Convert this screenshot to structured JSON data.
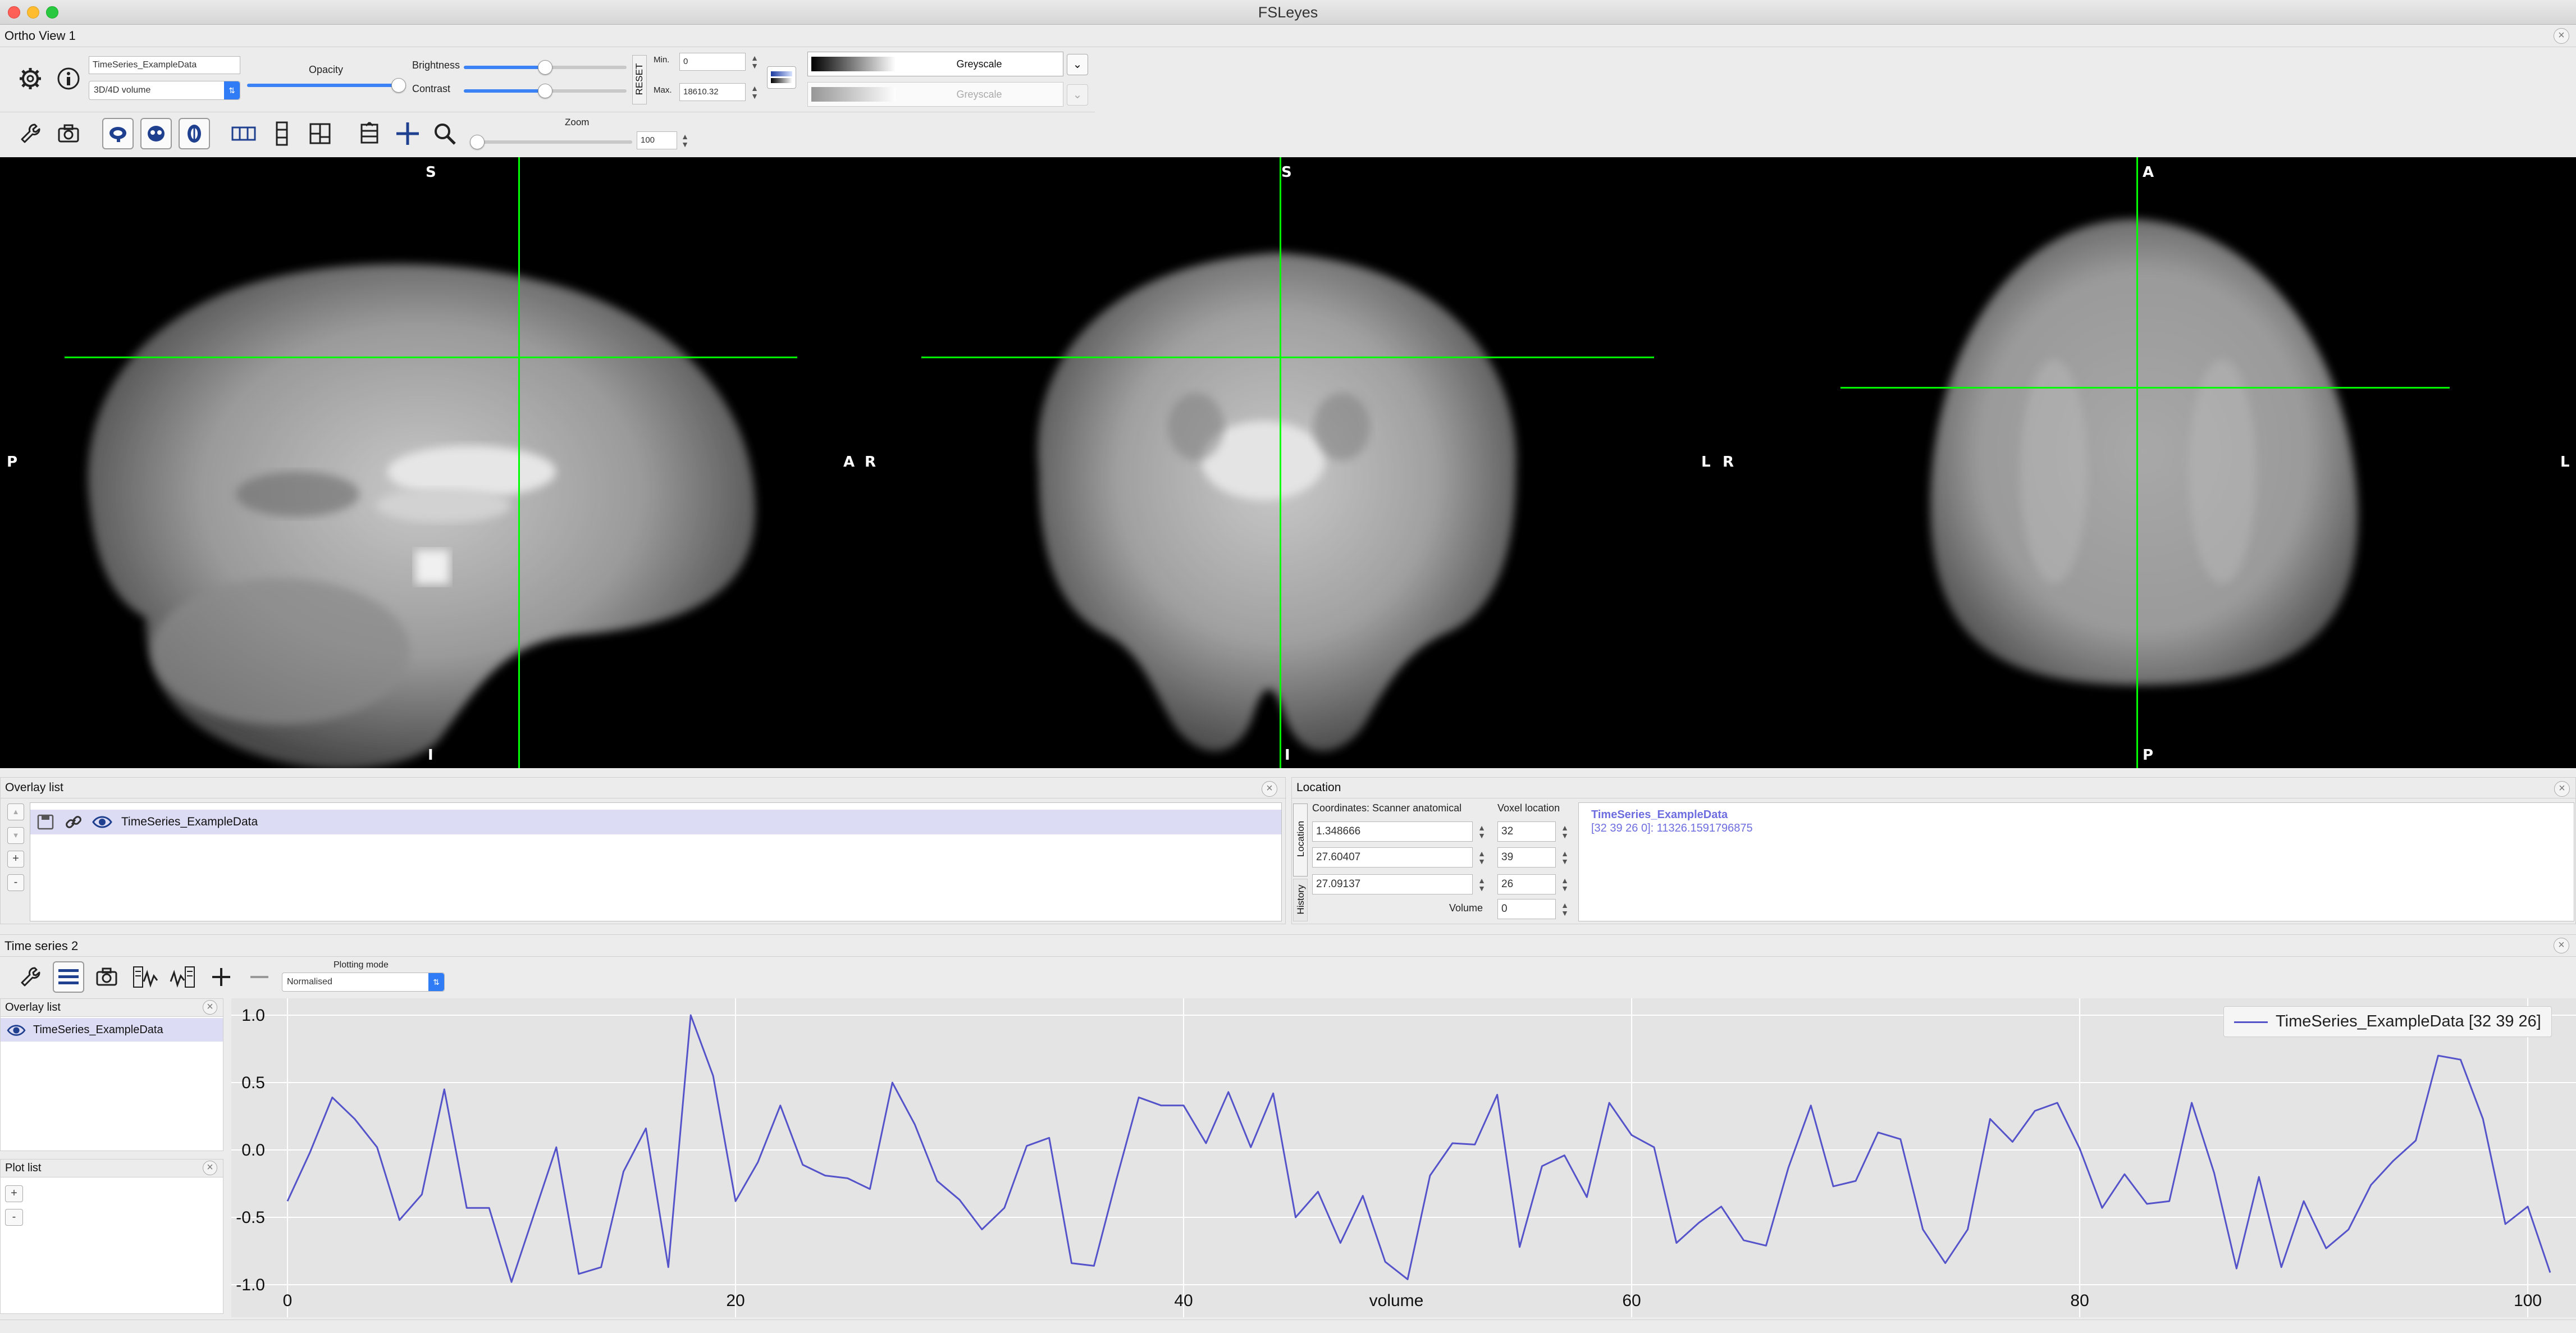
{
  "window": {
    "title": "FSLeyes"
  },
  "ortho": {
    "panel_title": "Ortho View 1",
    "overlay_name": "TimeSeries_ExampleData",
    "overlay_type": "3D/4D volume",
    "opacity_label": "Opacity",
    "brightness_label": "Brightness",
    "contrast_label": "Contrast",
    "reset_label": "RESET",
    "min_label": "Min.",
    "max_label": "Max.",
    "min_value": "0",
    "max_value": "18610.32",
    "colormap": "Greyscale",
    "neg_colormap": "Greyscale",
    "zoom_label": "Zoom",
    "zoom_value": "100",
    "opacity": 1.0,
    "brightness": 0.5,
    "contrast": 0.5,
    "zoom_level": 0.0,
    "views": {
      "sagittal": {
        "top": "S",
        "bottom": "I",
        "left": "P",
        "right": "A"
      },
      "coronal": {
        "top": "S",
        "bottom": "I",
        "left": "R",
        "right": "L"
      },
      "axial": {
        "top": "A",
        "bottom": "P",
        "left": "R",
        "right": "L"
      }
    }
  },
  "overlay_list": {
    "title": "Overlay list",
    "items": [
      {
        "name": "TimeSeries_ExampleData"
      }
    ],
    "buttons": {
      "up": "▲",
      "down": "▼",
      "add": "+",
      "remove": "-"
    }
  },
  "location": {
    "title": "Location",
    "tab_location": "Location",
    "tab_history": "History",
    "coords_header": "Coordinates: Scanner anatomical",
    "voxel_header": "Voxel location",
    "coords": [
      "1.348666",
      "27.60407",
      "27.09137"
    ],
    "voxels": [
      "32",
      "39",
      "26"
    ],
    "volume_label": "Volume",
    "volume_value": "0",
    "info_name": "TimeSeries_ExampleData",
    "info_value": "[32 39 26 0]: 11326.1591796875"
  },
  "timeseries": {
    "panel_title": "Time series 2",
    "plotting_mode_label": "Plotting mode",
    "plotting_mode": "Normalised",
    "overlay_list_title": "Overlay list",
    "overlay_item": "TimeSeries_ExampleData",
    "plot_list_title": "Plot list",
    "plot_buttons": {
      "add": "+",
      "remove": "-"
    }
  },
  "colors": {
    "series": "#5553c9",
    "crosshair": "#00ff00",
    "accent": "#2f7cf6",
    "selection": "#dcdcf5",
    "plot_bg": "#e4e4e4"
  },
  "chart_data": {
    "type": "line",
    "xlabel": "volume",
    "ylabel": "",
    "xlim": [
      0,
      101
    ],
    "ylim": [
      -1.0,
      1.0
    ],
    "x_ticks": [
      0,
      20,
      40,
      60,
      80,
      100
    ],
    "y_ticks": [
      1.0,
      0.5,
      0.0,
      -0.5,
      -1.0
    ],
    "x_tick_labels": [
      "0",
      "20",
      "40",
      "60",
      "80",
      "100"
    ],
    "y_tick_labels": [
      "1.0",
      "0.5",
      "0.0",
      "-0.5",
      "-1.0"
    ],
    "grid": true,
    "legend": "top-right",
    "series": [
      {
        "name": "TimeSeries_ExampleData [32 39 26]",
        "values": [
          -0.38,
          -0.02,
          0.39,
          0.23,
          0.02,
          -0.52,
          -0.33,
          0.45,
          -0.43,
          -0.43,
          -0.98,
          -0.48,
          0.02,
          -0.92,
          -0.87,
          -0.16,
          0.16,
          -0.87,
          1.0,
          0.55,
          -0.38,
          -0.09,
          0.33,
          -0.11,
          -0.19,
          -0.21,
          -0.29,
          0.5,
          0.19,
          -0.23,
          -0.37,
          -0.59,
          -0.43,
          0.03,
          0.09,
          -0.84,
          -0.86,
          -0.22,
          0.39,
          0.33,
          0.33,
          0.05,
          0.43,
          0.02,
          0.42,
          -0.5,
          -0.31,
          -0.69,
          -0.34,
          -0.83,
          -0.96,
          -0.19,
          0.05,
          0.04,
          0.41,
          -0.72,
          -0.12,
          -0.04,
          -0.35,
          0.35,
          0.11,
          0.02,
          -0.69,
          -0.54,
          -0.42,
          -0.67,
          -0.71,
          -0.13,
          0.33,
          -0.27,
          -0.23,
          0.13,
          0.08,
          -0.59,
          -0.84,
          -0.59,
          0.23,
          0.06,
          0.29,
          0.35,
          0.01,
          -0.43,
          -0.18,
          -0.4,
          -0.38,
          0.35,
          -0.17,
          -0.88,
          -0.2,
          -0.87,
          -0.38,
          -0.73,
          -0.59,
          -0.26,
          -0.08,
          0.07,
          0.7,
          0.67,
          0.23,
          -0.55,
          -0.42,
          -0.91
        ]
      }
    ]
  }
}
